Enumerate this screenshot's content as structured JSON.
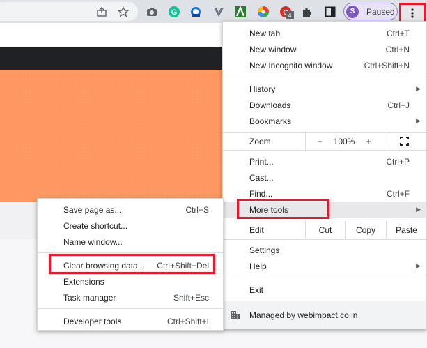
{
  "toolbar": {
    "icons": [
      "share-icon",
      "star-icon",
      "camera-icon",
      "grammarly-icon",
      "extension-b-icon",
      "vpn-icon",
      "adblock-icon",
      "color-picker-icon",
      "extension-badge-icon",
      "puzzle-icon",
      "sidebar-icon"
    ],
    "extension_badge": "4",
    "profile_initial": "S",
    "profile_status": "Paused"
  },
  "menu": {
    "new_tab": {
      "label": "New tab",
      "shortcut": "Ctrl+T"
    },
    "new_window": {
      "label": "New window",
      "shortcut": "Ctrl+N"
    },
    "new_incognito": {
      "label": "New Incognito window",
      "shortcut": "Ctrl+Shift+N"
    },
    "history": {
      "label": "History"
    },
    "downloads": {
      "label": "Downloads",
      "shortcut": "Ctrl+J"
    },
    "bookmarks": {
      "label": "Bookmarks"
    },
    "zoom": {
      "label": "Zoom",
      "minus": "−",
      "value": "100%",
      "plus": "+"
    },
    "print": {
      "label": "Print...",
      "shortcut": "Ctrl+P"
    },
    "cast": {
      "label": "Cast..."
    },
    "find": {
      "label": "Find...",
      "shortcut": "Ctrl+F"
    },
    "more_tools": {
      "label": "More tools"
    },
    "edit": {
      "label": "Edit",
      "cut": "Cut",
      "copy": "Copy",
      "paste": "Paste"
    },
    "settings": {
      "label": "Settings"
    },
    "help": {
      "label": "Help"
    },
    "exit": {
      "label": "Exit"
    },
    "managed": {
      "label": "Managed by webimpact.co.in"
    }
  },
  "submenu": {
    "save_page": {
      "label": "Save page as...",
      "shortcut": "Ctrl+S"
    },
    "create_shortcut": {
      "label": "Create shortcut..."
    },
    "name_window": {
      "label": "Name window..."
    },
    "clear_browsing": {
      "label": "Clear browsing data...",
      "shortcut": "Ctrl+Shift+Del"
    },
    "extensions": {
      "label": "Extensions"
    },
    "task_manager": {
      "label": "Task manager",
      "shortcut": "Shift+Esc"
    },
    "developer_tools": {
      "label": "Developer tools",
      "shortcut": "Ctrl+Shift+I"
    }
  },
  "colors": {
    "highlight_box": "#e8192c",
    "hero": "#ff9761",
    "profile_avatar": "#7e57c2"
  }
}
